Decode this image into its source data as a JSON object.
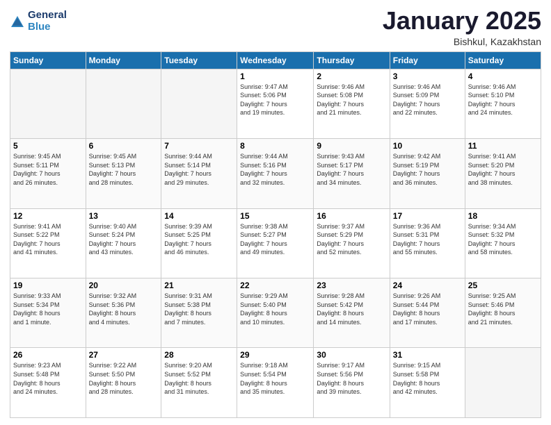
{
  "logo": {
    "general": "General",
    "blue": "Blue"
  },
  "header": {
    "title": "January 2025",
    "subtitle": "Bishkul, Kazakhstan"
  },
  "weekdays": [
    "Sunday",
    "Monday",
    "Tuesday",
    "Wednesday",
    "Thursday",
    "Friday",
    "Saturday"
  ],
  "weeks": [
    [
      {
        "day": "",
        "info": ""
      },
      {
        "day": "",
        "info": ""
      },
      {
        "day": "",
        "info": ""
      },
      {
        "day": "1",
        "info": "Sunrise: 9:47 AM\nSunset: 5:06 PM\nDaylight: 7 hours\nand 19 minutes."
      },
      {
        "day": "2",
        "info": "Sunrise: 9:46 AM\nSunset: 5:08 PM\nDaylight: 7 hours\nand 21 minutes."
      },
      {
        "day": "3",
        "info": "Sunrise: 9:46 AM\nSunset: 5:09 PM\nDaylight: 7 hours\nand 22 minutes."
      },
      {
        "day": "4",
        "info": "Sunrise: 9:46 AM\nSunset: 5:10 PM\nDaylight: 7 hours\nand 24 minutes."
      }
    ],
    [
      {
        "day": "5",
        "info": "Sunrise: 9:45 AM\nSunset: 5:11 PM\nDaylight: 7 hours\nand 26 minutes."
      },
      {
        "day": "6",
        "info": "Sunrise: 9:45 AM\nSunset: 5:13 PM\nDaylight: 7 hours\nand 28 minutes."
      },
      {
        "day": "7",
        "info": "Sunrise: 9:44 AM\nSunset: 5:14 PM\nDaylight: 7 hours\nand 29 minutes."
      },
      {
        "day": "8",
        "info": "Sunrise: 9:44 AM\nSunset: 5:16 PM\nDaylight: 7 hours\nand 32 minutes."
      },
      {
        "day": "9",
        "info": "Sunrise: 9:43 AM\nSunset: 5:17 PM\nDaylight: 7 hours\nand 34 minutes."
      },
      {
        "day": "10",
        "info": "Sunrise: 9:42 AM\nSunset: 5:19 PM\nDaylight: 7 hours\nand 36 minutes."
      },
      {
        "day": "11",
        "info": "Sunrise: 9:41 AM\nSunset: 5:20 PM\nDaylight: 7 hours\nand 38 minutes."
      }
    ],
    [
      {
        "day": "12",
        "info": "Sunrise: 9:41 AM\nSunset: 5:22 PM\nDaylight: 7 hours\nand 41 minutes."
      },
      {
        "day": "13",
        "info": "Sunrise: 9:40 AM\nSunset: 5:24 PM\nDaylight: 7 hours\nand 43 minutes."
      },
      {
        "day": "14",
        "info": "Sunrise: 9:39 AM\nSunset: 5:25 PM\nDaylight: 7 hours\nand 46 minutes."
      },
      {
        "day": "15",
        "info": "Sunrise: 9:38 AM\nSunset: 5:27 PM\nDaylight: 7 hours\nand 49 minutes."
      },
      {
        "day": "16",
        "info": "Sunrise: 9:37 AM\nSunset: 5:29 PM\nDaylight: 7 hours\nand 52 minutes."
      },
      {
        "day": "17",
        "info": "Sunrise: 9:36 AM\nSunset: 5:31 PM\nDaylight: 7 hours\nand 55 minutes."
      },
      {
        "day": "18",
        "info": "Sunrise: 9:34 AM\nSunset: 5:32 PM\nDaylight: 7 hours\nand 58 minutes."
      }
    ],
    [
      {
        "day": "19",
        "info": "Sunrise: 9:33 AM\nSunset: 5:34 PM\nDaylight: 8 hours\nand 1 minute."
      },
      {
        "day": "20",
        "info": "Sunrise: 9:32 AM\nSunset: 5:36 PM\nDaylight: 8 hours\nand 4 minutes."
      },
      {
        "day": "21",
        "info": "Sunrise: 9:31 AM\nSunset: 5:38 PM\nDaylight: 8 hours\nand 7 minutes."
      },
      {
        "day": "22",
        "info": "Sunrise: 9:29 AM\nSunset: 5:40 PM\nDaylight: 8 hours\nand 10 minutes."
      },
      {
        "day": "23",
        "info": "Sunrise: 9:28 AM\nSunset: 5:42 PM\nDaylight: 8 hours\nand 14 minutes."
      },
      {
        "day": "24",
        "info": "Sunrise: 9:26 AM\nSunset: 5:44 PM\nDaylight: 8 hours\nand 17 minutes."
      },
      {
        "day": "25",
        "info": "Sunrise: 9:25 AM\nSunset: 5:46 PM\nDaylight: 8 hours\nand 21 minutes."
      }
    ],
    [
      {
        "day": "26",
        "info": "Sunrise: 9:23 AM\nSunset: 5:48 PM\nDaylight: 8 hours\nand 24 minutes."
      },
      {
        "day": "27",
        "info": "Sunrise: 9:22 AM\nSunset: 5:50 PM\nDaylight: 8 hours\nand 28 minutes."
      },
      {
        "day": "28",
        "info": "Sunrise: 9:20 AM\nSunset: 5:52 PM\nDaylight: 8 hours\nand 31 minutes."
      },
      {
        "day": "29",
        "info": "Sunrise: 9:18 AM\nSunset: 5:54 PM\nDaylight: 8 hours\nand 35 minutes."
      },
      {
        "day": "30",
        "info": "Sunrise: 9:17 AM\nSunset: 5:56 PM\nDaylight: 8 hours\nand 39 minutes."
      },
      {
        "day": "31",
        "info": "Sunrise: 9:15 AM\nSunset: 5:58 PM\nDaylight: 8 hours\nand 42 minutes."
      },
      {
        "day": "",
        "info": ""
      }
    ]
  ]
}
